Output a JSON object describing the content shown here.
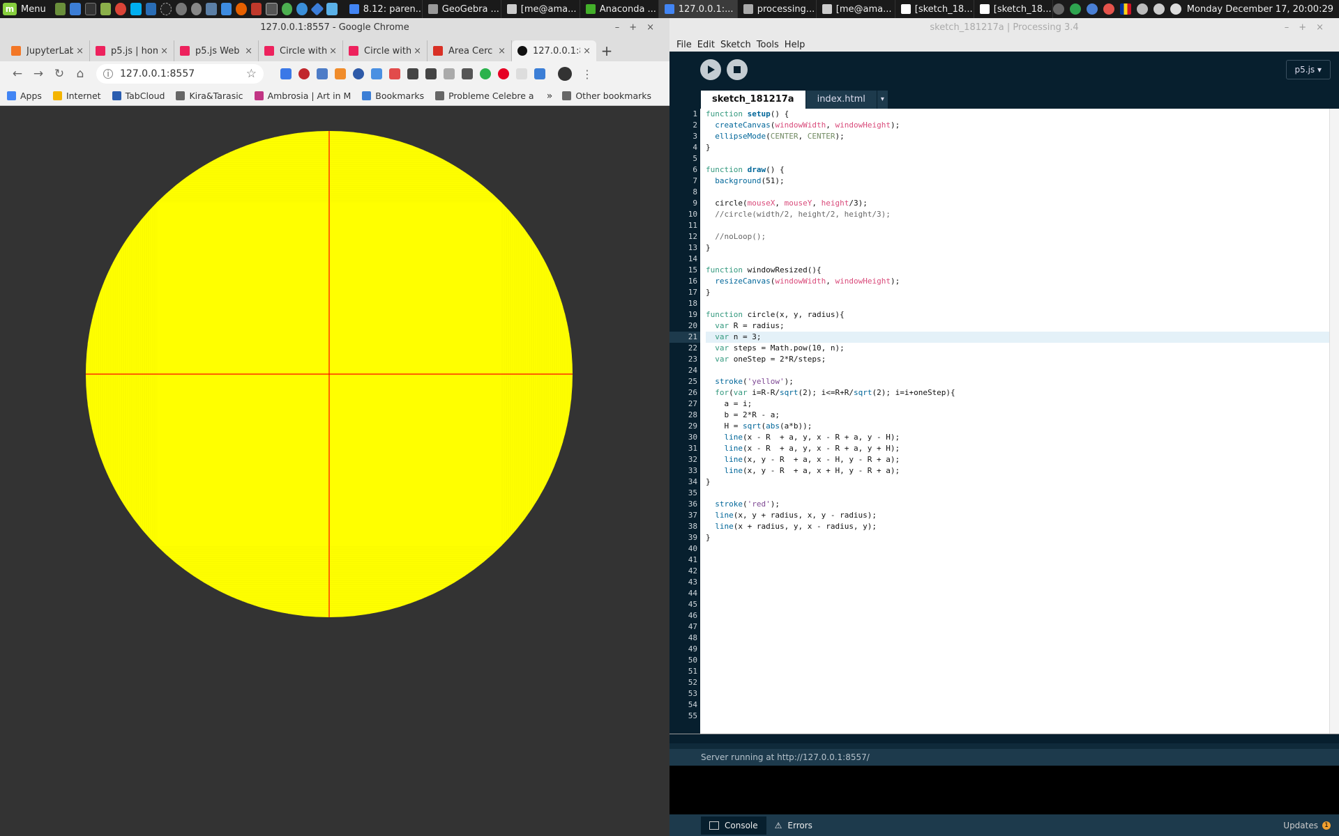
{
  "taskbar": {
    "menu_label": "Menu",
    "tasks": [
      {
        "label": "8.12: paren...",
        "color": "#4285f4"
      },
      {
        "label": "GeoGebra ...",
        "color": "#999999"
      },
      {
        "label": "[me@ama...",
        "color": "#cccccc"
      },
      {
        "label": "Anaconda ...",
        "color": "#43b02a"
      },
      {
        "label": "127.0.0.1:...",
        "color": "#4285f4",
        "active": true
      },
      {
        "label": "processing...",
        "color": "#aaaaaa"
      },
      {
        "label": "[me@ama...",
        "color": "#cccccc"
      },
      {
        "label": "[sketch_18...",
        "color": "#ffffff"
      },
      {
        "label": "[sketch_18...",
        "color": "#ffffff"
      }
    ],
    "clock": "Monday December 17, 20:00:29"
  },
  "chrome": {
    "window_title": "127.0.0.1:8557 - Google Chrome",
    "tabs": [
      {
        "label": "JupyterLab",
        "icon": "jupyter-icon",
        "color": "#f37726"
      },
      {
        "label": "p5.js | hom",
        "icon": "p5-icon",
        "color": "#ed225d"
      },
      {
        "label": "p5.js Web E",
        "icon": "p5-icon",
        "color": "#ed225d"
      },
      {
        "label": "Circle with",
        "icon": "p5-icon",
        "color": "#ed225d"
      },
      {
        "label": "Circle with",
        "icon": "p5-icon",
        "color": "#ed225d"
      },
      {
        "label": "Area Cerc",
        "icon": "gmail-icon",
        "color": "#d93025"
      },
      {
        "label": "127.0.0.1:8",
        "icon": "play-icon",
        "color": "#111111",
        "active": true
      }
    ],
    "url": "127.0.0.1:8557",
    "bookmarks": [
      {
        "label": "Apps",
        "icon": "apps-grid-icon"
      },
      {
        "label": "Internet",
        "icon": "site-icon"
      },
      {
        "label": "TabCloud",
        "icon": "cloud-icon"
      },
      {
        "label": "Kira&Tarasic",
        "icon": "folder-icon"
      },
      {
        "label": "Ambrosia | Art in M",
        "icon": "instagram-icon"
      },
      {
        "label": "Bookmarks",
        "icon": "star-icon"
      },
      {
        "label": "Probleme Celebre a",
        "icon": "folder-icon"
      }
    ],
    "other_bookmarks": "Other bookmarks",
    "sketch_colors": {
      "background": "#333333",
      "fill": "#ffff00",
      "stroke": "#ffff00",
      "axis": "#ff0000"
    }
  },
  "ide": {
    "window_title": "sketch_181217a | Processing 3.4",
    "menu": [
      "File",
      "Edit",
      "Sketch",
      "Tools",
      "Help"
    ],
    "mode": "p5.js ▾",
    "tabs": [
      {
        "label": "sketch_181217a",
        "active": true
      },
      {
        "label": "index.html",
        "active": false
      }
    ],
    "tab_dropdown": "▾",
    "current_line": 21,
    "total_lines": 55,
    "code_lines": [
      "function setup() {",
      "  createCanvas(windowWidth, windowHeight);",
      "  ellipseMode(CENTER, CENTER);",
      "}",
      "",
      "function draw() {",
      "  background(51);",
      "",
      "  circle(mouseX, mouseY, height/3);",
      "  //circle(width/2, height/2, height/3);",
      "",
      "  //noLoop();",
      "}",
      "",
      "function windowResized(){",
      "  resizeCanvas(windowWidth, windowHeight);",
      "}",
      "",
      "function circle(x, y, radius){",
      "  var R = radius;",
      "  var n = 3;",
      "  var steps = Math.pow(10, n);",
      "  var oneStep = 2*R/steps;",
      "",
      "  stroke('yellow');",
      "  for(var i=R-R/sqrt(2); i<=R+R/sqrt(2); i=i+oneStep){",
      "    a = i;",
      "    b = 2*R - a;",
      "    H = sqrt(abs(a*b));",
      "    line(x - R  + a, y, x - R + a, y - H);",
      "    line(x - R  + a, y, x - R + a, y + H);",
      "    line(x, y - R  + a, x - H, y - R + a);",
      "    line(x, y - R  + a, x + H, y - R + a);",
      "}",
      "",
      "  stroke('red');",
      "  line(x, y + radius, x, y - radius);",
      "  line(x + radius, y, x - radius, y);",
      "}"
    ],
    "status": "Server running at http://127.0.0.1:8557/",
    "footer": {
      "console": "Console",
      "errors": "Errors",
      "updates": "Updates",
      "updates_count": "1"
    }
  }
}
